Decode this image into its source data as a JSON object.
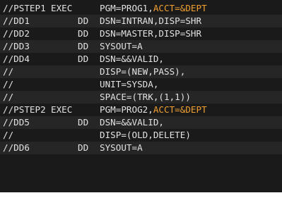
{
  "code_block": {
    "accent_color": "#f0a030",
    "lines": [
      {
        "name": "//PSTEP1",
        "op": "EXEC",
        "param": "PGM=PROG1,",
        "highlight": "ACCT=&DEPT"
      },
      {
        "name": "//DD1",
        "op": "DD",
        "param": "DSN=INTRAN,DISP=SHR",
        "highlight": ""
      },
      {
        "name": "//DD2",
        "op": "DD",
        "param": "DSN=MASTER,DISP=SHR",
        "highlight": ""
      },
      {
        "name": "//DD3",
        "op": "DD",
        "param": "SYSOUT=A",
        "highlight": ""
      },
      {
        "name": "//DD4",
        "op": "DD",
        "param": "DSN=&&VALID,",
        "highlight": ""
      },
      {
        "name": "//",
        "op": "",
        "param": "DISP=(NEW,PASS),",
        "highlight": ""
      },
      {
        "name": "//",
        "op": "",
        "param": "UNIT=SYSDA,",
        "highlight": ""
      },
      {
        "name": "//",
        "op": "",
        "param": "SPACE=(TRK,(1,1))",
        "highlight": ""
      },
      {
        "name": "//PSTEP2",
        "op": "EXEC",
        "param": "PGM=PROG2,",
        "highlight": "ACCT=&DEPT"
      },
      {
        "name": "//DD5",
        "op": "DD",
        "param": "DSN=&&VALID,",
        "highlight": ""
      },
      {
        "name": "//",
        "op": "",
        "param": "DISP=(OLD,DELETE)",
        "highlight": ""
      },
      {
        "name": "//DD6",
        "op": "DD",
        "param": "SYSOUT=A",
        "highlight": ""
      }
    ]
  }
}
